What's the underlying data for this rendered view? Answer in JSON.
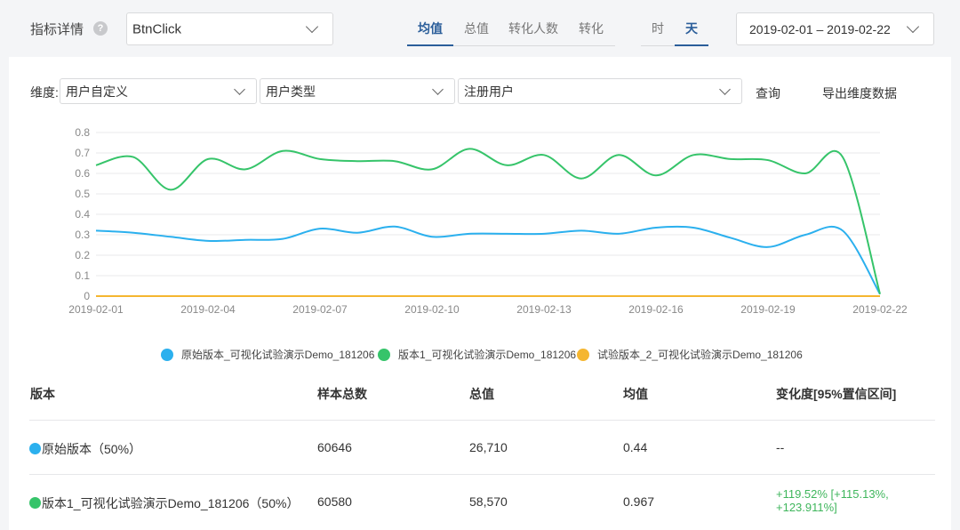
{
  "header": {
    "metric_label": "指标详情",
    "help_icon": "question-icon",
    "metric_select_value": "BtnClick",
    "tabs": [
      {
        "label": "均值",
        "active": true
      },
      {
        "label": "总值",
        "active": false
      },
      {
        "label": "转化人数",
        "active": false
      },
      {
        "label": "转化",
        "active": false
      }
    ],
    "granularity": [
      {
        "label": "时",
        "active": false
      },
      {
        "label": "天",
        "active": true
      }
    ],
    "date_range": "2019-02-01 – 2019-02-22"
  },
  "dimension": {
    "label": "维度:",
    "selects": [
      "用户自定义",
      "用户类型",
      "注册用户"
    ],
    "query_label": "查询",
    "export_label": "导出维度数据"
  },
  "chart_data": {
    "type": "line",
    "x": [
      "2019-02-01",
      "2019-02-02",
      "2019-02-03",
      "2019-02-04",
      "2019-02-05",
      "2019-02-06",
      "2019-02-07",
      "2019-02-08",
      "2019-02-09",
      "2019-02-10",
      "2019-02-11",
      "2019-02-12",
      "2019-02-13",
      "2019-02-14",
      "2019-02-15",
      "2019-02-16",
      "2019-02-17",
      "2019-02-18",
      "2019-02-19",
      "2019-02-20",
      "2019-02-21",
      "2019-02-22"
    ],
    "x_tick_labels": [
      "2019-02-01",
      "2019-02-04",
      "2019-02-07",
      "2019-02-10",
      "2019-02-13",
      "2019-02-16",
      "2019-02-19",
      "2019-02-22"
    ],
    "y_ticks": [
      "0",
      "0.1",
      "0.2",
      "0.3",
      "0.4",
      "0.5",
      "0.6",
      "0.7",
      "0.8"
    ],
    "ylim": [
      0,
      0.8
    ],
    "grid": true,
    "legend_position": "bottom",
    "series": [
      {
        "name": "原始版本_可视化试验演示Demo_181206",
        "color": "#2bb0ee",
        "values": [
          0.32,
          0.31,
          0.29,
          0.27,
          0.275,
          0.28,
          0.33,
          0.31,
          0.34,
          0.29,
          0.305,
          0.305,
          0.305,
          0.32,
          0.305,
          0.335,
          0.335,
          0.285,
          0.24,
          0.3,
          0.32,
          0.01
        ]
      },
      {
        "name": "版本1_可视化试验演示Demo_181206",
        "color": "#36c46a",
        "values": [
          0.64,
          0.68,
          0.52,
          0.67,
          0.62,
          0.71,
          0.67,
          0.66,
          0.66,
          0.62,
          0.72,
          0.64,
          0.69,
          0.575,
          0.69,
          0.59,
          0.69,
          0.67,
          0.665,
          0.6,
          0.68,
          0.01
        ]
      },
      {
        "name": "试验版本_2_可视化试验演示Demo_181206",
        "color": "#f5b630",
        "values": [
          0,
          0,
          0,
          0,
          0,
          0,
          0,
          0,
          0,
          0,
          0,
          0,
          0,
          0,
          0,
          0,
          0,
          0,
          0,
          0,
          0,
          0
        ]
      }
    ]
  },
  "table": {
    "headers": [
      "版本",
      "样本总数",
      "总值",
      "均值",
      "变化度[95%置信区间]"
    ],
    "rows": [
      {
        "name": "原始版本（50%）",
        "dot_color": "#2bb0ee",
        "samples": "60646",
        "total": "26,710",
        "mean": "0.44",
        "change": "--"
      },
      {
        "name": "版本1_可视化试验演示Demo_181206（50%）",
        "dot_color": "#36c46a",
        "samples": "60580",
        "total": "58,570",
        "mean": "0.967",
        "change": "+119.52% [+115.13%, +123.911%]"
      }
    ]
  }
}
